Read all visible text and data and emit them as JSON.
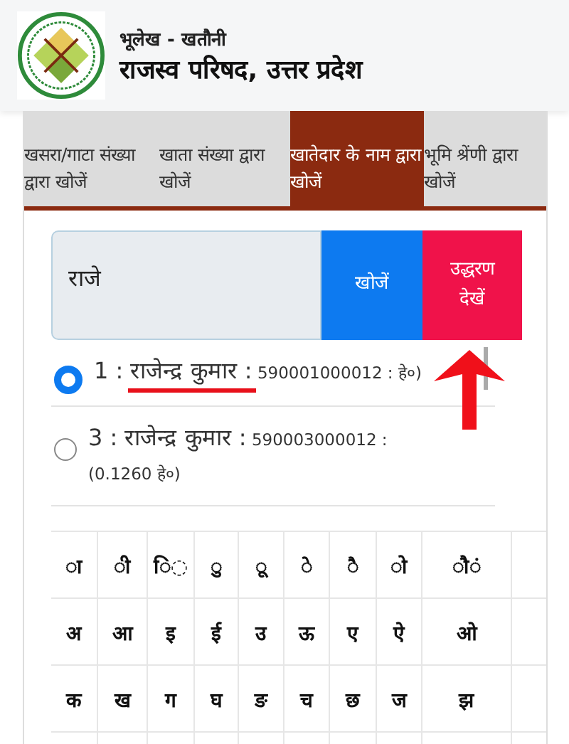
{
  "header": {
    "subtitle": "भूलेख - खतौनी",
    "title": "राजस्व परिषद, उत्तर प्रदेश"
  },
  "tabs": [
    {
      "label": "खसरा/गाटा संख्या द्वारा खोजें",
      "selected": false
    },
    {
      "label": "खाता संख्या द्वारा खोजें",
      "selected": false
    },
    {
      "label": "खातेदार के नाम द्वारा खोजें",
      "selected": true
    },
    {
      "label": "भूमि श्रेंणी द्वारा खोजें",
      "selected": false
    }
  ],
  "search": {
    "value": "राजे",
    "search_button": "खोजें",
    "view_button": "उद्धरण देखें"
  },
  "results": [
    {
      "name": "1 : राजेन्द्र कुमार :",
      "detail": "590001000012 : हे०)",
      "selected": true,
      "annotated": true
    },
    {
      "name": "3 : राजेन्द्र कुमार :",
      "detail": "590003000012 : (0.1260 हे०)",
      "selected": false,
      "annotated": false
    }
  ],
  "keyboard": [
    [
      "◌ा",
      "◌ी",
      "ि◌",
      "◌ु",
      "◌ू",
      "◌े",
      "◌ै",
      "◌ो",
      "◌ौ◌ं"
    ],
    [
      "अ",
      "आ",
      "इ",
      "ई",
      "उ",
      "ऊ",
      "ए",
      "ऐ",
      "ओ"
    ],
    [
      "क",
      "ख",
      "ग",
      "घ",
      "ङ",
      "च",
      "छ",
      "ज",
      "झ"
    ]
  ]
}
